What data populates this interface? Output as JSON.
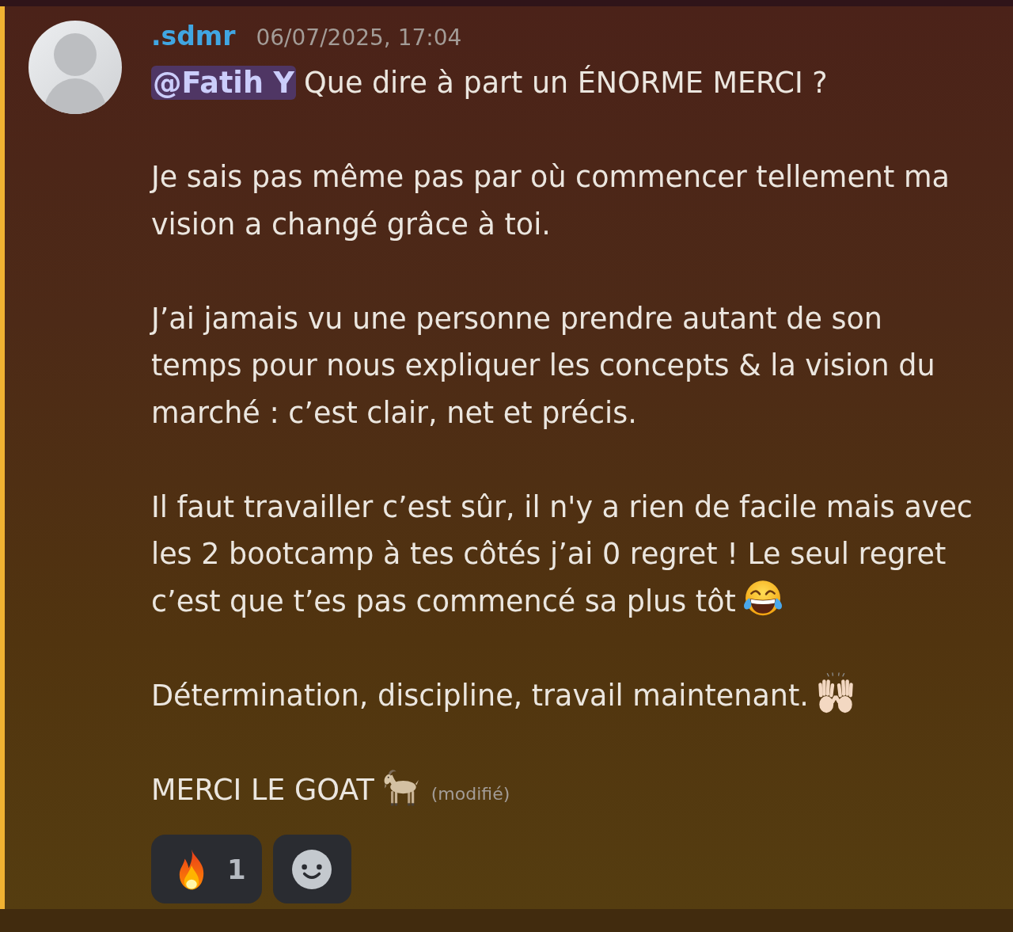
{
  "message": {
    "highlighted": true,
    "author": ".sdmr",
    "timestamp": "06/07/2025, 17:04",
    "paragraphs": [
      {
        "runs": [
          {
            "kind": "mention",
            "text": "@Fatih Y"
          },
          {
            "kind": "text",
            "text": "Que dire à part un ÉNORME MERCI ?"
          }
        ]
      },
      {
        "runs": [
          {
            "kind": "text",
            "text": "Je sais pas même pas par où commencer tellement ma vision a changé grâce à toi."
          }
        ]
      },
      {
        "runs": [
          {
            "kind": "text",
            "text": "J’ai jamais vu une personne prendre autant de son temps pour nous expliquer les concepts & la vision du marché : c’est clair, net et précis."
          }
        ]
      },
      {
        "runs": [
          {
            "kind": "text",
            "text": "Il faut travailler c’est sûr, il n'y a rien de facile mais avec les 2 bootcamp à tes côtés j’ai 0 regret ! Le seul regret c’est que t’es pas commencé sa plus tôt"
          },
          {
            "kind": "joy"
          }
        ]
      },
      {
        "runs": [
          {
            "kind": "text",
            "text": "Détermination, discipline, travail maintenant."
          },
          {
            "kind": "raised_hands"
          }
        ]
      },
      {
        "runs": [
          {
            "kind": "text",
            "text": "MERCI LE GOAT"
          },
          {
            "kind": "goat"
          }
        ]
      }
    ],
    "edited_label": "(modifié)",
    "reactions": [
      {
        "kind": "fire",
        "count": "1",
        "selected": false
      }
    ]
  }
}
